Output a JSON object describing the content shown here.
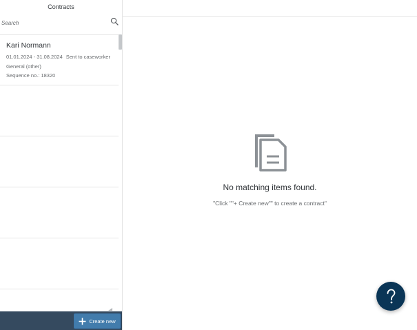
{
  "master": {
    "title": "Contracts",
    "search": {
      "placeholder": "Search",
      "value": ""
    },
    "items": [
      {
        "name": "Kari Normann",
        "period": "01.01.2024 - 31.08.2024",
        "status": "Sent to caseworker",
        "type": "General (other)",
        "sequence": "Sequence no.: 18320"
      }
    ],
    "create_label": "Create new"
  },
  "detail": {
    "empty_title": "No matching items found.",
    "empty_description": "\"Click \"\"+ Create new\"\" to create a contract\""
  },
  "colors": {
    "footer": "#354a5f",
    "button": "#427cac",
    "help_fab": "#0a3556",
    "empty_icon": "#8c9196"
  }
}
